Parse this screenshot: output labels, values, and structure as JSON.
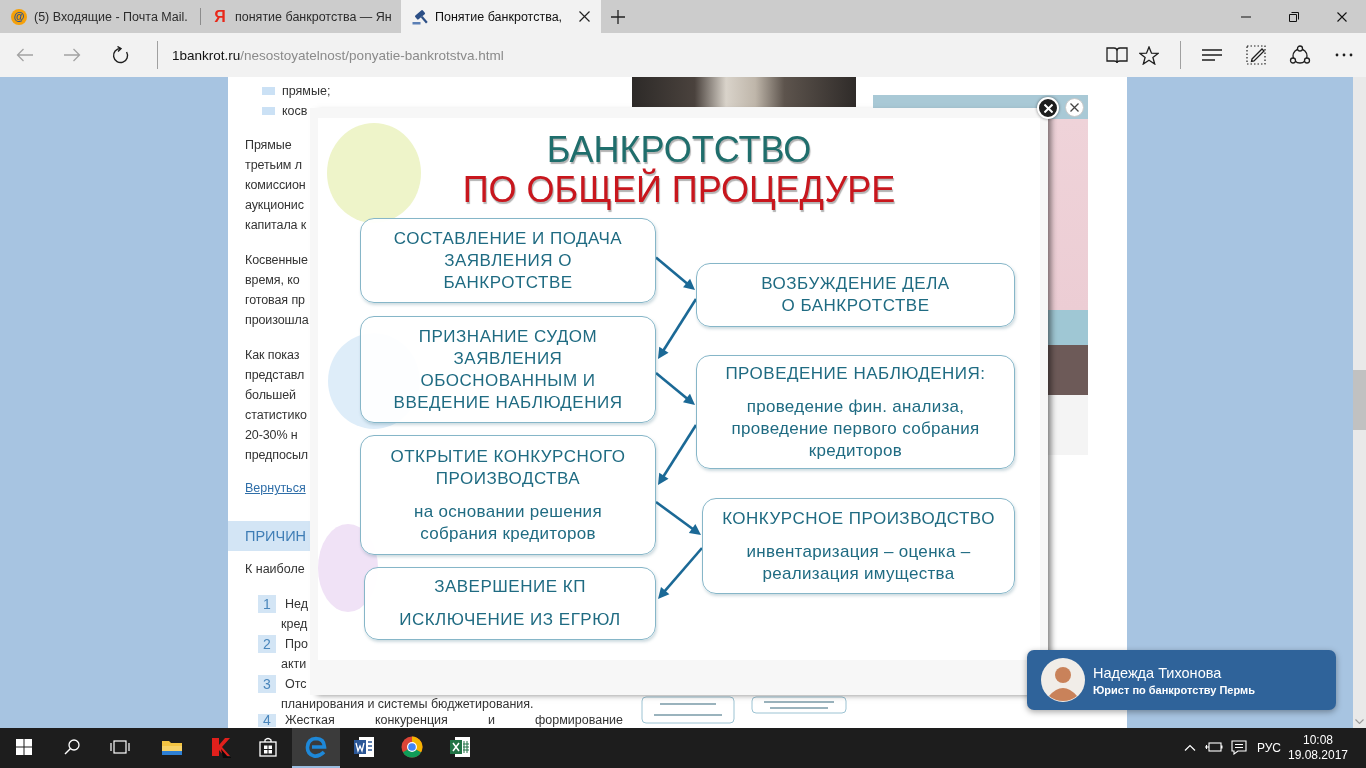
{
  "browser": {
    "tabs": [
      {
        "favicon": "@",
        "title": "(5) Входящие - Почта Mail.",
        "selected": false
      },
      {
        "favicon": "Я",
        "title": "понятие банкротства — Ян",
        "selected": false
      },
      {
        "title": "Понятие банкротства,",
        "selected": true
      }
    ],
    "back": {
      "disabled": true
    },
    "forward": {
      "disabled": true
    },
    "address": {
      "domain": "1bankrot.ru",
      "path": "/nesostoyatelnost/ponyatie-bankrotstva.html"
    }
  },
  "article": {
    "bullets": [
      "прямые;",
      "косв"
    ],
    "paragraphs": [
      [
        "Прямые",
        "третьим л",
        "комиссион",
        "аукционис",
        "капитала к"
      ],
      [
        "Косвенные",
        "время, ко",
        "готовая пр",
        "произошла"
      ],
      [
        "Как показ",
        "представл",
        "большей",
        "статистико",
        "20-30% н",
        "предпосыл"
      ]
    ],
    "link": "Вернуться",
    "heading": "ПРИЧИН",
    "intro": "К наиболе",
    "list": [
      {
        "number": "1",
        "lines": [
          "Нед",
          "кред"
        ]
      },
      {
        "number": "2",
        "lines": [
          "Про",
          "акти"
        ]
      },
      {
        "number": "3",
        "lines": [
          "Отс",
          "планирования и системы бюджетирования."
        ]
      },
      {
        "number": "4",
        "lines": [
          "Жесткая конкуренция и формирование"
        ]
      }
    ]
  },
  "lightbox": {
    "title": "БАНКРОТСТВО",
    "subtitle": "ПО ОБЩЕЙ ПРОЦЕДУРЕ",
    "steps": [
      {
        "parts": [
          {
            "kind": "heading",
            "text": "СОСТАВЛЕНИЕ И ПОДАЧА\nЗАЯВЛЕНИЯ О\nБАНКРОТСТВЕ"
          }
        ]
      },
      {
        "parts": [
          {
            "kind": "heading",
            "text": "ВОЗБУЖДЕНИЕ ДЕЛА\nО БАНКРОТСТВЕ"
          }
        ]
      },
      {
        "parts": [
          {
            "kind": "heading",
            "text": "ПРИЗНАНИЕ СУДОМ\nЗАЯВЛЕНИЯ\nОБОСНОВАННЫМ И\nВВЕДЕНИЕ НАБЛЮДЕНИЯ"
          }
        ]
      },
      {
        "parts": [
          {
            "kind": "heading",
            "text": "ПРОВЕДЕНИЕ НАБЛЮДЕНИЯ:"
          },
          {
            "kind": "note",
            "text": "проведение фин. анализа,\nпроведение первого собрания\nкредиторов"
          }
        ]
      },
      {
        "parts": [
          {
            "kind": "heading",
            "text": "ОТКРЫТИЕ КОНКУРСНОГО\nПРОИЗВОДСТВА"
          },
          {
            "kind": "note",
            "text": "на основании решения\nсобрания кредиторов"
          }
        ]
      },
      {
        "parts": [
          {
            "kind": "heading",
            "text": "КОНКУРСНОЕ ПРОИЗВОДСТВО"
          },
          {
            "kind": "note",
            "text": "инвентаризация – оценка –\nреализация имущества"
          }
        ]
      },
      {
        "parts": [
          {
            "kind": "heading",
            "text": "ЗАВЕРШЕНИЕ КП"
          },
          {
            "kind": "heading",
            "text": "ИСКЛЮЧЕНИЕ ИЗ ЕГРЮЛ"
          }
        ]
      }
    ]
  },
  "chat": {
    "name": "Надежда Тихонова",
    "role": "Юрист по банкротству Пермь"
  },
  "taskbar": {
    "apps": [
      {
        "selected": false
      },
      {
        "selected": false
      },
      {
        "selected": false
      },
      {
        "selected": true
      },
      {
        "selected": false
      },
      {
        "selected": false
      },
      {
        "selected": false
      }
    ],
    "language": "РУС",
    "time": "10:08",
    "date": "19.08.2017"
  }
}
